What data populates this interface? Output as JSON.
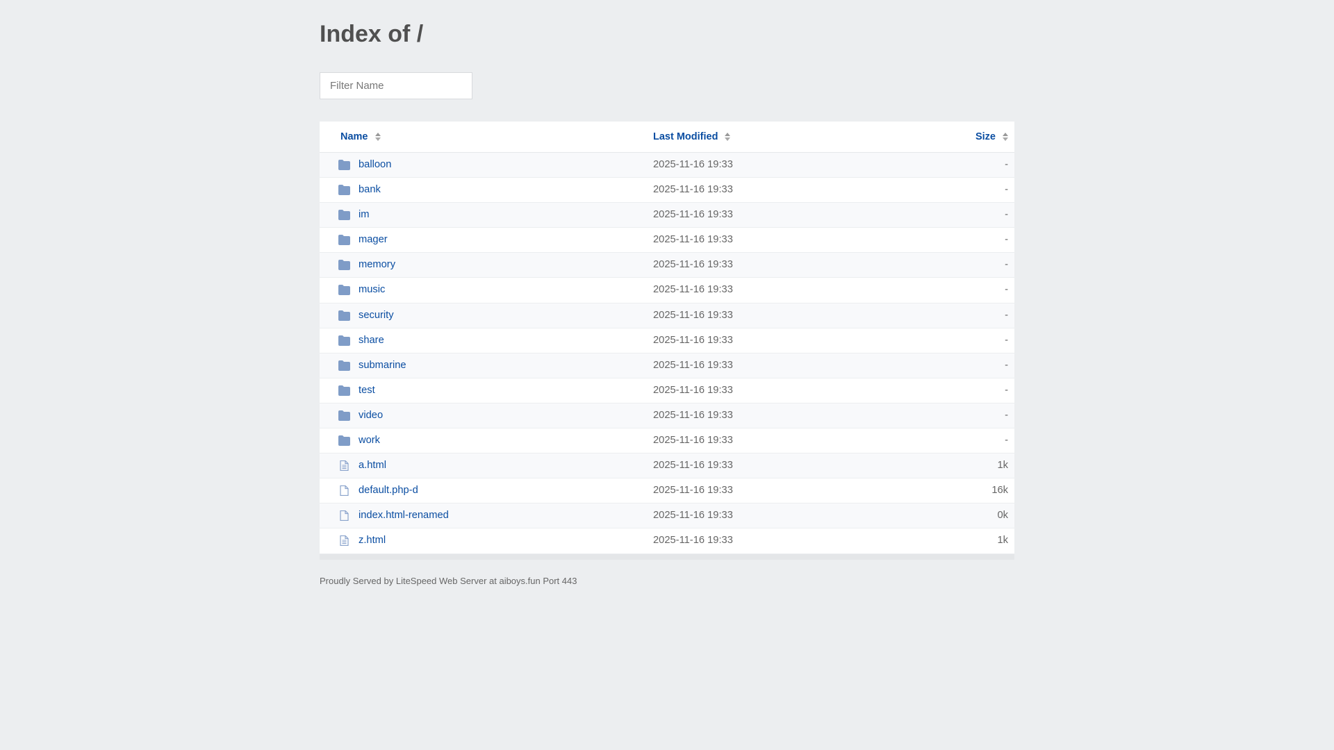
{
  "title": "Index of /",
  "filter": {
    "placeholder": "Filter Name",
    "value": ""
  },
  "columns": {
    "name": "Name",
    "modified": "Last Modified",
    "size": "Size"
  },
  "rows": [
    {
      "name": "balloon",
      "type": "folder",
      "modified": "2025-11-16 19:33",
      "size": "-"
    },
    {
      "name": "bank",
      "type": "folder",
      "modified": "2025-11-16 19:33",
      "size": "-"
    },
    {
      "name": "im",
      "type": "folder",
      "modified": "2025-11-16 19:33",
      "size": "-"
    },
    {
      "name": "mager",
      "type": "folder",
      "modified": "2025-11-16 19:33",
      "size": "-"
    },
    {
      "name": "memory",
      "type": "folder",
      "modified": "2025-11-16 19:33",
      "size": "-"
    },
    {
      "name": "music",
      "type": "folder",
      "modified": "2025-11-16 19:33",
      "size": "-"
    },
    {
      "name": "security",
      "type": "folder",
      "modified": "2025-11-16 19:33",
      "size": "-"
    },
    {
      "name": "share",
      "type": "folder",
      "modified": "2025-11-16 19:33",
      "size": "-"
    },
    {
      "name": "submarine",
      "type": "folder",
      "modified": "2025-11-16 19:33",
      "size": "-"
    },
    {
      "name": "test",
      "type": "folder",
      "modified": "2025-11-16 19:33",
      "size": "-"
    },
    {
      "name": "video",
      "type": "folder",
      "modified": "2025-11-16 19:33",
      "size": "-"
    },
    {
      "name": "work",
      "type": "folder",
      "modified": "2025-11-16 19:33",
      "size": "-"
    },
    {
      "name": "a.html",
      "type": "text",
      "modified": "2025-11-16 19:33",
      "size": "1k"
    },
    {
      "name": "default.php-d",
      "type": "file",
      "modified": "2025-11-16 19:33",
      "size": "16k"
    },
    {
      "name": "index.html-renamed",
      "type": "file",
      "modified": "2025-11-16 19:33",
      "size": "0k"
    },
    {
      "name": "z.html",
      "type": "text",
      "modified": "2025-11-16 19:33",
      "size": "1k"
    }
  ],
  "footer": "Proudly Served by LiteSpeed Web Server at aiboys.fun Port 443",
  "colors": {
    "link": "#0b4ea2",
    "background": "#eceef0",
    "folder": "#7f9cc7"
  }
}
